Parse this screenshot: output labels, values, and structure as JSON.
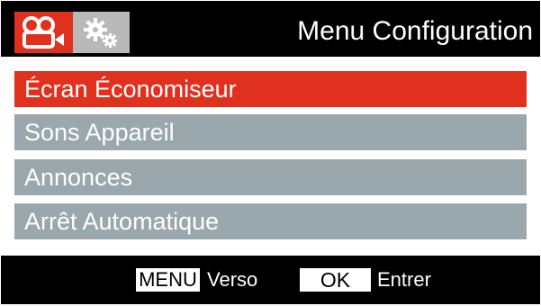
{
  "header": {
    "title": "Menu Configuration",
    "tabs": [
      {
        "icon": "video-camera-icon",
        "active": true,
        "color": "#e0301e"
      },
      {
        "icon": "gears-icon",
        "active": false,
        "color": "#b9b9b9"
      }
    ]
  },
  "menu": {
    "items": [
      {
        "label": "Écran Économiseur",
        "selected": true
      },
      {
        "label": "Sons Appareil",
        "selected": false
      },
      {
        "label": "Annonces",
        "selected": false
      },
      {
        "label": "Arrêt Automatique",
        "selected": false
      }
    ]
  },
  "footer": {
    "menu_key": "MENU",
    "menu_action": "Verso",
    "ok_key": "OK",
    "ok_action": "Entrer"
  },
  "colors": {
    "accent": "#e0301e",
    "item_background": "#9aa7ad",
    "background": "#000000"
  }
}
